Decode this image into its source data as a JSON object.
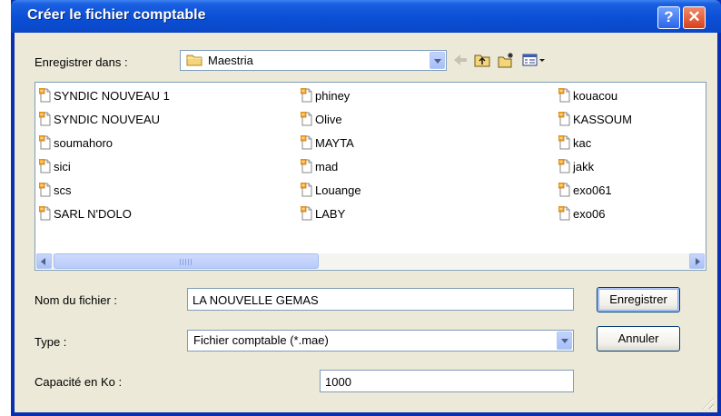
{
  "window": {
    "title": "Créer le fichier comptable",
    "help_label": "?",
    "close_label": "✕"
  },
  "save_in": {
    "label": "Enregistrer dans :",
    "value": "Maestria"
  },
  "toolbar": {
    "icons": [
      "back-icon",
      "up-folder-icon",
      "new-folder-icon",
      "views-menu-icon"
    ]
  },
  "files": {
    "col1": [
      "SYNDIC NOUVEAU 1",
      "SYNDIC NOUVEAU",
      "soumahoro",
      "sici",
      "scs",
      "SARL N'DOLO"
    ],
    "col2": [
      "phiney",
      "Olive",
      "MAYTA",
      "mad",
      "Louange",
      "LABY"
    ],
    "col3": [
      "kouacou",
      "KASSOUM",
      "kac",
      "jakk",
      "exo061",
      "exo06"
    ]
  },
  "filename": {
    "label": "Nom du fichier :",
    "value": "LA NOUVELLE GEMAS"
  },
  "type": {
    "label": "Type :",
    "value": "Fichier comptable (*.mae)"
  },
  "capacity": {
    "label": "Capacité en Ko :",
    "value": "1000"
  },
  "buttons": {
    "save": "Enregistrer",
    "cancel": "Annuler"
  },
  "colors": {
    "title_bar": "#0a47c6",
    "dialog_bg": "#ece9d8",
    "close_button": "#d8401b"
  }
}
